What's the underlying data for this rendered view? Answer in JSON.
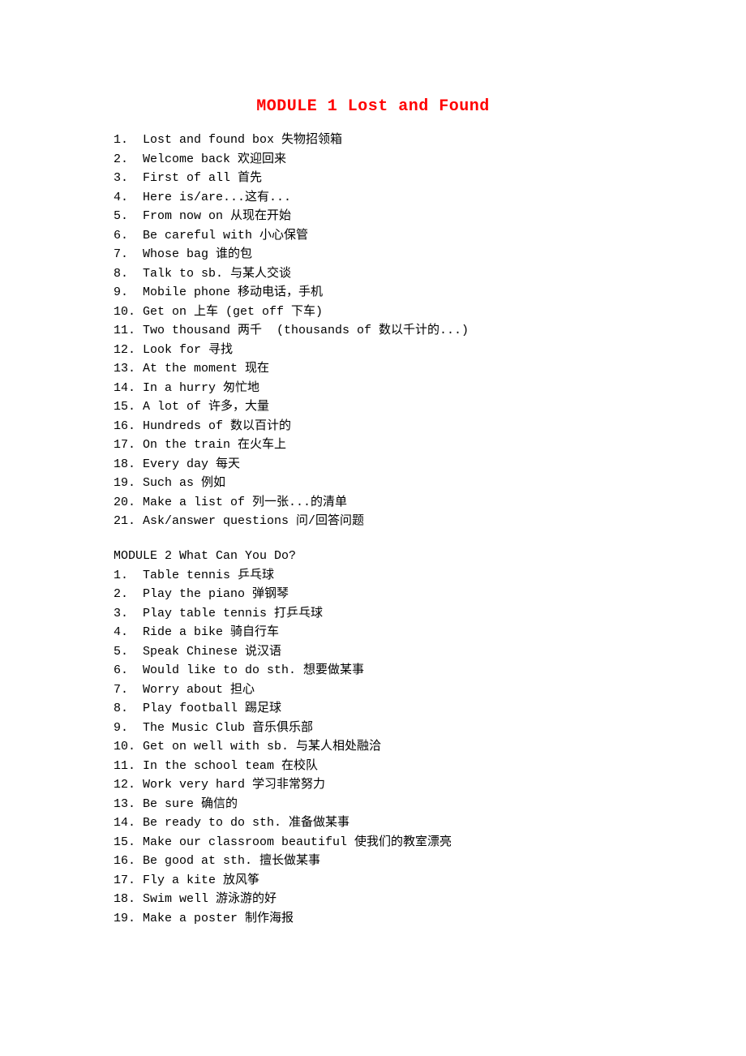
{
  "title": "MODULE 1 Lost and Found",
  "module1": {
    "items": [
      {
        "n": "1. ",
        "text": "Lost and found box 失物招领箱"
      },
      {
        "n": "2. ",
        "text": "Welcome back 欢迎回来"
      },
      {
        "n": "3. ",
        "text": "First of all 首先"
      },
      {
        "n": "4. ",
        "text": "Here is/are...这有..."
      },
      {
        "n": "5. ",
        "text": "From now on 从现在开始"
      },
      {
        "n": "6. ",
        "text": "Be careful with 小心保管"
      },
      {
        "n": "7. ",
        "text": "Whose bag 谁的包"
      },
      {
        "n": "8. ",
        "text": "Talk to sb. 与某人交谈"
      },
      {
        "n": "9. ",
        "text": "Mobile phone 移动电话，手机"
      },
      {
        "n": "10.",
        "text": "Get on 上车 (get off 下车)"
      },
      {
        "n": "11.",
        "text": "Two thousand 两千  (thousands of 数以千计的...)"
      },
      {
        "n": "12.",
        "text": "Look for 寻找"
      },
      {
        "n": "13.",
        "text": "At the moment 现在"
      },
      {
        "n": "14.",
        "text": "In a hurry 匆忙地"
      },
      {
        "n": "15.",
        "text": "A lot of 许多，大量"
      },
      {
        "n": "16.",
        "text": "Hundreds of 数以百计的"
      },
      {
        "n": "17.",
        "text": "On the train 在火车上"
      },
      {
        "n": "18.",
        "text": "Every day 每天"
      },
      {
        "n": "19.",
        "text": "Such as 例如"
      },
      {
        "n": "20.",
        "text": "Make a list of 列一张...的清单"
      },
      {
        "n": "21.",
        "text": "Ask/answer questions 问/回答问题"
      }
    ]
  },
  "module2": {
    "heading": "MODULE 2 What Can You Do?",
    "items": [
      {
        "n": "1. ",
        "text": "Table tennis 乒乓球"
      },
      {
        "n": "2. ",
        "text": "Play the piano 弹钢琴"
      },
      {
        "n": "3. ",
        "text": "Play table tennis 打乒乓球"
      },
      {
        "n": "4. ",
        "text": "Ride a bike 骑自行车"
      },
      {
        "n": "5. ",
        "text": "Speak Chinese 说汉语"
      },
      {
        "n": "6. ",
        "text": "Would like to do sth. 想要做某事"
      },
      {
        "n": "7. ",
        "text": "Worry about 担心"
      },
      {
        "n": "8. ",
        "text": "Play football 踢足球"
      },
      {
        "n": "9. ",
        "text": "The Music Club 音乐俱乐部"
      },
      {
        "n": "10.",
        "text": "Get on well with sb. 与某人相处融洽"
      },
      {
        "n": "11.",
        "text": "In the school team 在校队"
      },
      {
        "n": "12.",
        "text": "Work very hard 学习非常努力"
      },
      {
        "n": "13.",
        "text": "Be sure 确信的"
      },
      {
        "n": "14.",
        "text": "Be ready to do sth. 准备做某事"
      },
      {
        "n": "15.",
        "text": "Make our classroom beautiful 使我们的教室漂亮"
      },
      {
        "n": "16.",
        "text": "Be good at sth. 擅长做某事"
      },
      {
        "n": "17.",
        "text": "Fly a kite 放风筝"
      },
      {
        "n": "18.",
        "text": "Swim well 游泳游的好"
      },
      {
        "n": "19.",
        "text": "Make a poster 制作海报"
      }
    ]
  }
}
